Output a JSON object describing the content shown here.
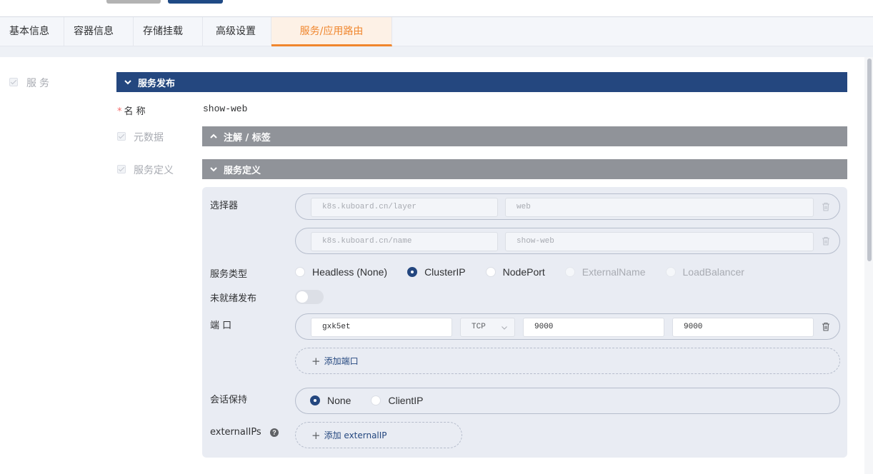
{
  "tabs": [
    {
      "label": "基本信息"
    },
    {
      "label": "容器信息"
    },
    {
      "label": "存储挂载"
    },
    {
      "label": "高级设置"
    },
    {
      "label": "服务/应用路由",
      "active": true
    }
  ],
  "left": {
    "service_label": "服务"
  },
  "publish": {
    "header": "服务发布",
    "name_label": "名 称",
    "name_value": "show-web",
    "metadata_label": "元数据",
    "annotations_header": "注解 / 标签",
    "definition_label": "服务定义",
    "definition_header": "服务定义"
  },
  "selector": {
    "label": "选择器",
    "rows": [
      {
        "key": "k8s.kuboard.cn/layer",
        "value": "web"
      },
      {
        "key": "k8s.kuboard.cn/name",
        "value": "show-web"
      }
    ]
  },
  "service_type": {
    "label": "服务类型",
    "options": [
      {
        "label": "Headless (None)"
      },
      {
        "label": "ClusterIP"
      },
      {
        "label": "NodePort"
      },
      {
        "label": "ExternalName"
      },
      {
        "label": "LoadBalancer"
      }
    ],
    "selected": "ClusterIP"
  },
  "unready": {
    "label": "未就绪发布",
    "on": false
  },
  "port": {
    "label": "端 口",
    "rows": [
      {
        "name": "gxk5et",
        "protocol": "TCP",
        "port": "9000",
        "target_port": "9000"
      }
    ],
    "add_label": "添加端口"
  },
  "session": {
    "label": "会话保持",
    "options": [
      {
        "label": "None"
      },
      {
        "label": "ClientIP"
      }
    ],
    "selected": "None"
  },
  "external_ips": {
    "label": "externalIPs",
    "help": "?",
    "add_label": "添加 externalIP"
  },
  "colors": {
    "primary": "#24477f",
    "accent": "#f0862d",
    "grey_bar": "#909399"
  }
}
